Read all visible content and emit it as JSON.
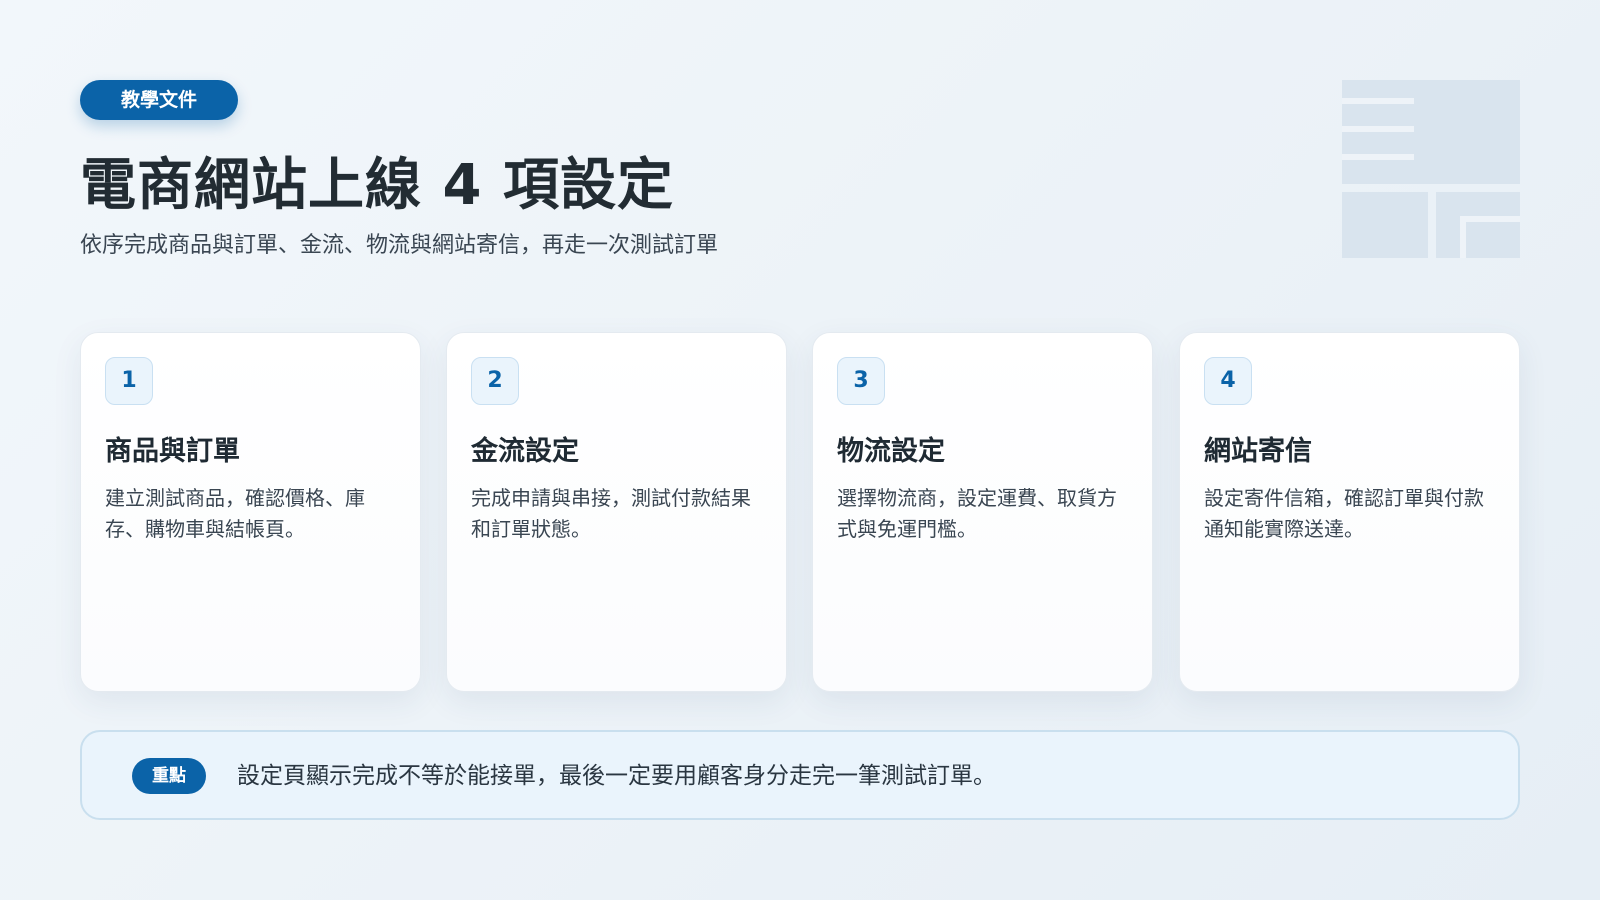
{
  "header": {
    "badge": "教學文件",
    "title": "電商網站上線 4 項設定",
    "subtitle": "依序完成商品與訂單、金流、物流與網站寄信，再走一次測試訂單"
  },
  "cards": [
    {
      "number": "1",
      "title": "商品與訂單",
      "description": "建立測試商品，確認價格、庫存、購物車與結帳頁。"
    },
    {
      "number": "2",
      "title": "金流設定",
      "description": "完成申請與串接，測試付款結果和訂單狀態。"
    },
    {
      "number": "3",
      "title": "物流設定",
      "description": "選擇物流商，設定運費、取貨方式與免運門檻。"
    },
    {
      "number": "4",
      "title": "網站寄信",
      "description": "設定寄件信箱，確認訂單與付款通知能實際送達。"
    }
  ],
  "note": {
    "tag": "重點",
    "text": "設定頁顯示完成不等於能接單，最後一定要用顧客身分走完一筆測試訂單。"
  },
  "colors": {
    "accent": "#0b63a8",
    "note_background": "#eaf4fc"
  }
}
